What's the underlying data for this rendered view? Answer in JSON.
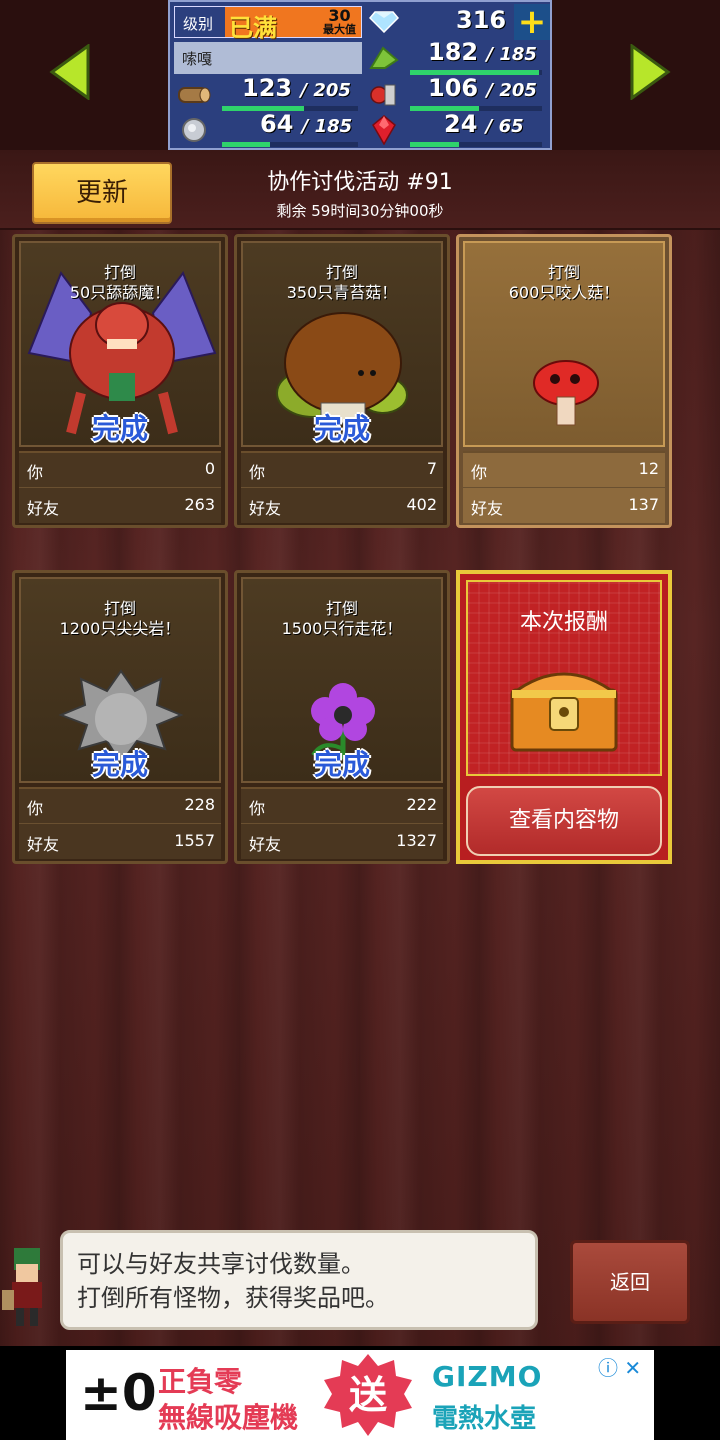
{
  "stats": {
    "level_label": "级别",
    "level_value": "已满",
    "level_max": [
      "30",
      "最大值"
    ],
    "diamonds": "316",
    "player_name": "嗦嘎",
    "grass": {
      "value": "182",
      "max": "185",
      "fill": 0.98
    },
    "wood": {
      "value": "123",
      "max": "205",
      "fill": 0.6
    },
    "food": {
      "value": "106",
      "max": "205",
      "fill": 0.52
    },
    "ore": {
      "value": "64",
      "max": "185",
      "fill": 0.35
    },
    "gem": {
      "value": "24",
      "max": "65",
      "fill": 0.37
    },
    "separator": "/"
  },
  "header": {
    "update_label": "更新",
    "event_title": "协作讨伐活动 #91",
    "event_remaining": "剩余 59时间30分钟00秒"
  },
  "labels": {
    "you": "你",
    "friend": "好友",
    "done": "完成"
  },
  "cards": [
    {
      "task_line1": "打倒",
      "task_line2": "50只舔舔魔！",
      "you": "0",
      "friend": "263",
      "done": true
    },
    {
      "task_line1": "打倒",
      "task_line2": "350只青苔菇！",
      "you": "7",
      "friend": "402",
      "done": true
    },
    {
      "task_line1": "打倒",
      "task_line2": "600只咬人菇！",
      "you": "12",
      "friend": "137",
      "done": false
    },
    {
      "task_line1": "打倒",
      "task_line2": "1200只尖尖岩！",
      "you": "228",
      "friend": "1557",
      "done": true
    },
    {
      "task_line1": "打倒",
      "task_line2": "1500只行走花！",
      "you": "222",
      "friend": "1327",
      "done": true
    }
  ],
  "reward": {
    "title": "本次报酬",
    "button": "查看内容物"
  },
  "dialog": {
    "line1": "可以与好友共享讨伐数量。",
    "line2": "打倒所有怪物，获得奖品吧。"
  },
  "back_label": "返回",
  "ad": {
    "num": "±0",
    "line1": "正負零",
    "line2": "無線吸塵機",
    "badge": "送",
    "brand": "GIZMO",
    "product": "電熱水壺",
    "icons": "ⓘ ✕"
  }
}
